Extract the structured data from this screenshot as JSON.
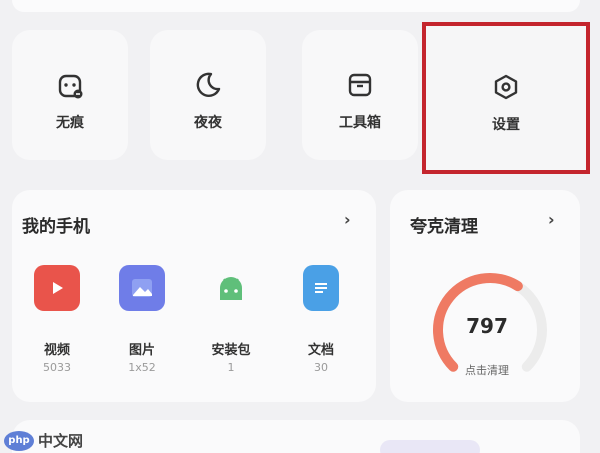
{
  "quick_actions": [
    {
      "label": "无痕",
      "icon": "incognito-icon"
    },
    {
      "label": "夜夜",
      "icon": "moon-icon"
    },
    {
      "label": "工具箱",
      "icon": "toolbox-icon"
    },
    {
      "label": "设置",
      "icon": "settings-icon"
    }
  ],
  "my_phone": {
    "title": "我的手机",
    "chevron": "›",
    "apps": [
      {
        "name": "视频",
        "count": "5033",
        "icon": "video-icon",
        "color": "#e9544b"
      },
      {
        "name": "图片",
        "count": "1x52",
        "icon": "image-icon",
        "color": "#6f7de8"
      },
      {
        "name": "安装包",
        "count": "1",
        "icon": "android-icon",
        "color": "#5fbf7a"
      },
      {
        "name": "文档",
        "count": "30",
        "icon": "document-icon",
        "color": "#4aa0e6"
      }
    ]
  },
  "clean": {
    "title": "夸克清理",
    "chevron": "›",
    "value": "797",
    "label": "点击清理",
    "gauge_fraction": 0.62,
    "gauge_color": "#ef7a63"
  },
  "watermark": {
    "logo": "php",
    "text": "中文网"
  },
  "colors": {
    "highlight": "#c4252d"
  }
}
